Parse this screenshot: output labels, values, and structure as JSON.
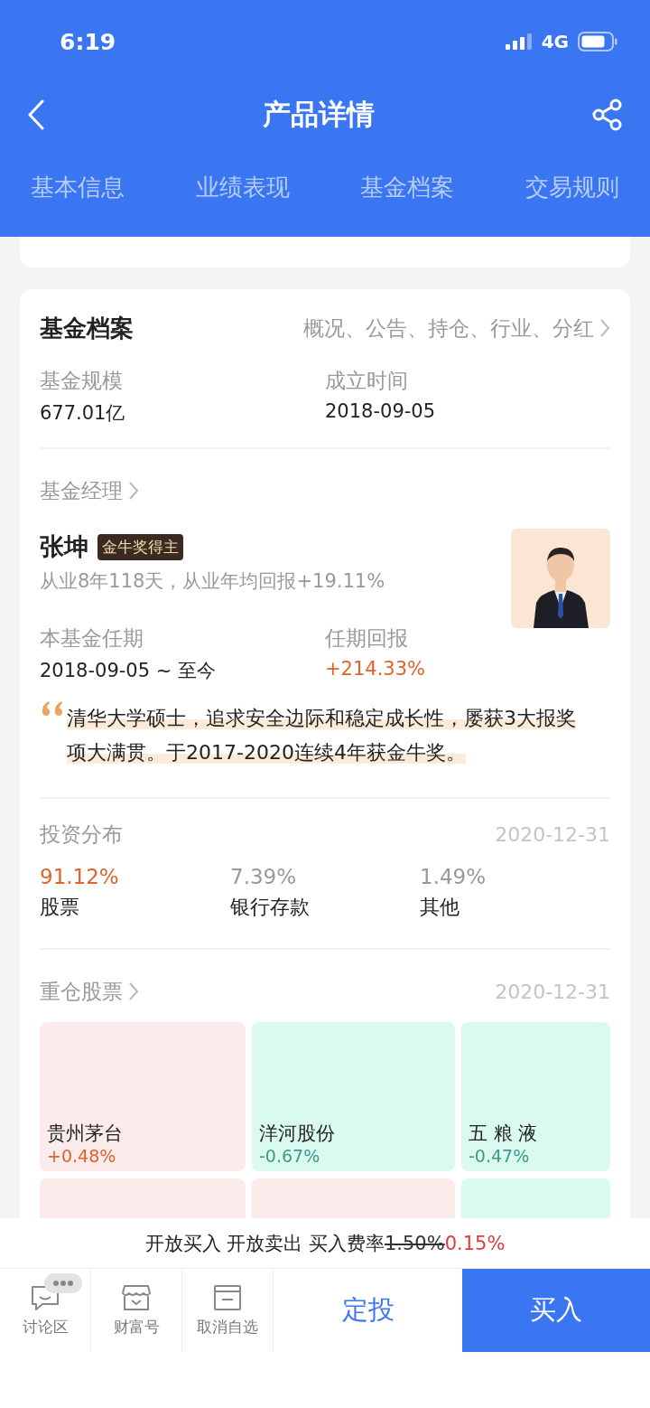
{
  "status_bar": {
    "time": "6:19",
    "network": "4G"
  },
  "header": {
    "title": "产品详情"
  },
  "tabs": [
    {
      "label": "基本信息",
      "selected": false
    },
    {
      "label": "业绩表现",
      "selected": false
    },
    {
      "label": "基金档案",
      "selected": false
    },
    {
      "label": "交易规则",
      "selected": false
    }
  ],
  "fund_profile": {
    "title": "基金档案",
    "link": "概况、公告、持仓、行业、分红",
    "stats": [
      {
        "label": "基金规模",
        "value": "677.01亿"
      },
      {
        "label": "成立时间",
        "value": "2018-09-05"
      }
    ]
  },
  "manager": {
    "section": "基金经理",
    "name": "张坤",
    "badge": "金牛奖得主",
    "summary": "从业8年118天，从业年均回报+19.11%",
    "stats": [
      {
        "label": "本基金任期",
        "value": "2018-09-05 ~ 至今",
        "kind": "plain"
      },
      {
        "label": "任期回报",
        "value": "+214.33%",
        "kind": "gain"
      }
    ],
    "quote": "清华大学硕士，追求安全边际和稳定成长性，屡获3大报奖项大满贯。于2017-2020连续4年获金牛奖。"
  },
  "distribution": {
    "title": "投资分布",
    "date": "2020-12-31",
    "items": [
      {
        "value": "91.12%",
        "label": "股票",
        "kind": "main"
      },
      {
        "value": "7.39%",
        "label": "银行存款",
        "kind": "minor"
      },
      {
        "value": "1.49%",
        "label": "其他",
        "kind": "minor"
      }
    ]
  },
  "holdings": {
    "title": "重仓股票",
    "date": "2020-12-31",
    "stocks": [
      {
        "name": "贵州茅台",
        "change": "+0.48%",
        "kind": "up"
      },
      {
        "name": "洋河股份",
        "change": "-0.67%",
        "kind": "down"
      },
      {
        "name": "五 粮 液",
        "change": "-0.47%",
        "kind": "down"
      }
    ],
    "next_row": [
      {
        "kind": "up"
      },
      {
        "kind": "up"
      },
      {
        "kind": "down"
      }
    ]
  },
  "trade_info": {
    "status": "开放买入 开放卖出",
    "fee_label": "买入费率",
    "old_fee": "1.50%",
    "fee": "0.15%"
  },
  "bottom_bar": {
    "items": [
      {
        "label": "讨论区",
        "kind": "chat"
      },
      {
        "label": "财富号",
        "kind": "shop"
      },
      {
        "label": "取消自选",
        "kind": "watch"
      }
    ],
    "plan_button": "定投",
    "buy_button": "买入"
  }
}
